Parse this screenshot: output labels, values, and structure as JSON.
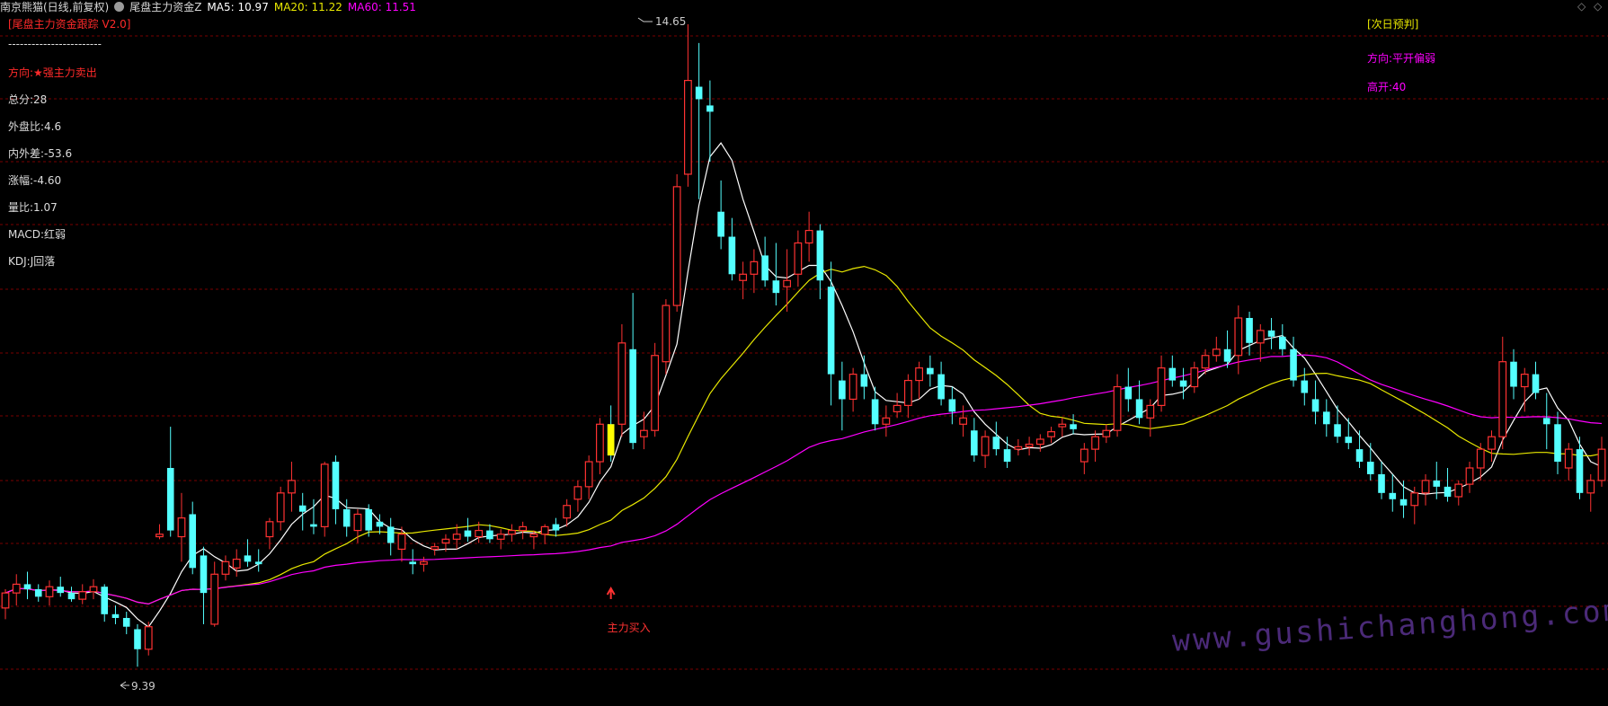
{
  "header": {
    "stock": "南京熊猫(日线,前复权)",
    "indicator": "尾盘主力资金Z",
    "ma5": "MA5: 10.97",
    "ma20": "MA20: 11.22",
    "ma60": "MA60: 11.51"
  },
  "left_panel": {
    "title": "[尾盘主力资金跟踪 V2.0]",
    "divider": "------------------------",
    "direction": "方向:★强主力卖出",
    "score": "总分:28",
    "outer_ratio": "外盘比:4.6",
    "diff": "内外差:-53.6",
    "change": "涨幅:-4.60",
    "vol_ratio": "量比:1.07",
    "macd": "MACD:红弱",
    "kdj": "KDJ:J回落"
  },
  "right_panel": {
    "title": "[次日预判]",
    "direction": "方向:平开偏弱",
    "gap": "高开:40"
  },
  "annotations": {
    "high": "14.65",
    "low": "9.39",
    "buy_signal": "主力买入"
  },
  "watermark": "www.gushichanghong.com",
  "corner_icons": [
    "diamond-icon",
    "diamond-icon"
  ],
  "colors": {
    "up": "#ff3232",
    "down": "#54ffff",
    "ma5": "#ffffff",
    "ma20": "#e8e800",
    "ma60": "#ff00ff",
    "grid": "#7a0000",
    "signal": "#ffff00"
  },
  "chart_data": {
    "type": "candlestick",
    "price_range": [
      9.39,
      14.65
    ],
    "series": [
      {
        "name": "MA5"
      },
      {
        "name": "MA20"
      },
      {
        "name": "MA60"
      }
    ]
  }
}
